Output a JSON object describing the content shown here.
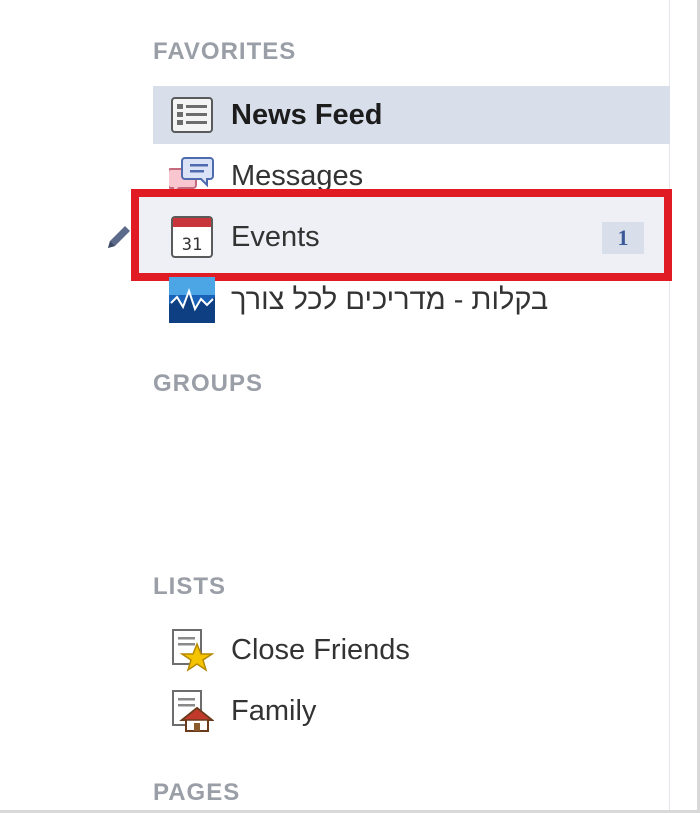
{
  "sections": {
    "favorites": "FAVORITES",
    "groups": "GROUPS",
    "lists": "LISTS",
    "pages": "PAGES"
  },
  "favorites": [
    {
      "label": "News Feed",
      "icon": "news-feed-icon",
      "selected": true
    },
    {
      "label": "Messages",
      "icon": "messages-icon"
    },
    {
      "label": "Events",
      "icon": "calendar-icon",
      "calendar_day": "31",
      "badge": "1",
      "highlighted": true
    },
    {
      "label": "בקלות - מדריכים לכל צורך",
      "icon": "page-app-icon"
    }
  ],
  "lists": [
    {
      "label": "Close Friends",
      "icon": "close-friends-star-icon"
    },
    {
      "label": "Family",
      "icon": "family-house-icon"
    }
  ],
  "colors": {
    "highlight": "#e01b24",
    "selected_bg": "#d8dfea",
    "section_head": "#9a9ea7",
    "badge_text": "#3b5998"
  }
}
